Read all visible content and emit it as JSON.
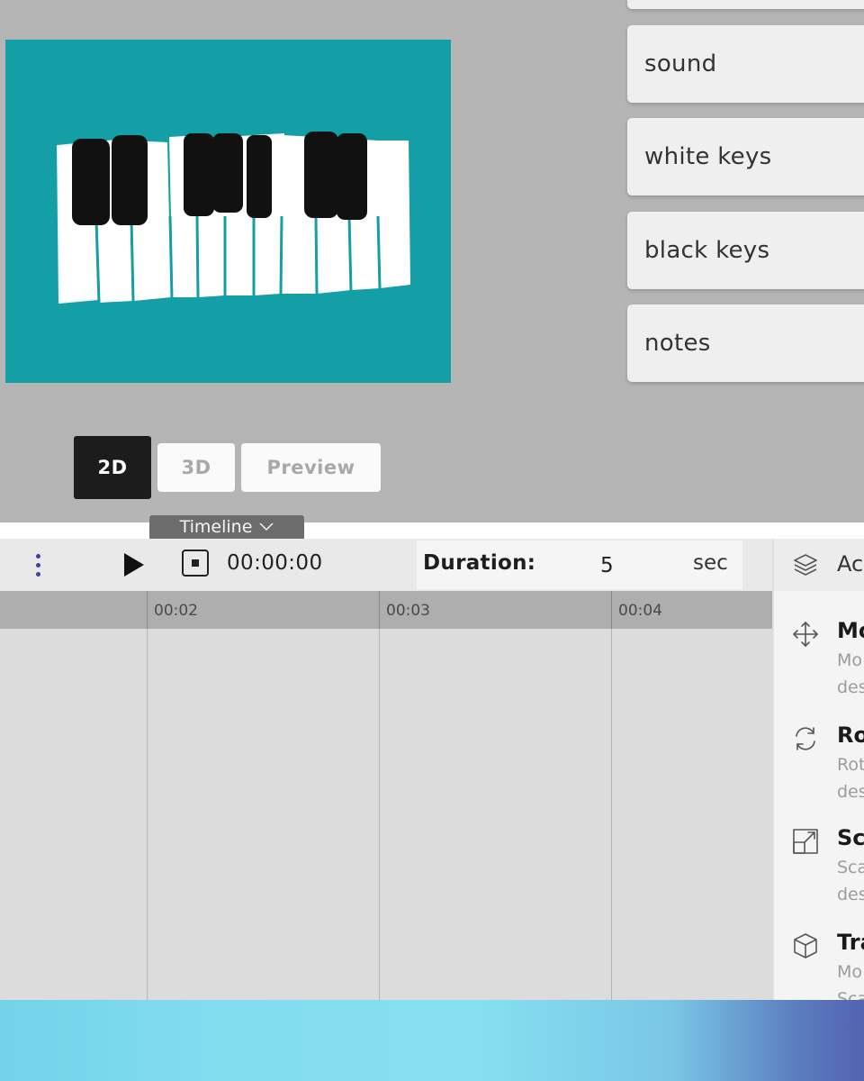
{
  "layers": {
    "items": [
      {
        "label": ""
      },
      {
        "label": "sound"
      },
      {
        "label": "white keys"
      },
      {
        "label": "black keys"
      },
      {
        "label": "notes"
      }
    ]
  },
  "modes": {
    "twod": "2D",
    "threed": "3D",
    "preview": "Preview",
    "active": "2D"
  },
  "timeline": {
    "toggle_label": "Timeline",
    "current_time": "00:00:00",
    "duration_label": "Duration:",
    "duration_value": "5",
    "duration_unit": "sec",
    "ticks": [
      "00:02",
      "00:03",
      "00:04"
    ]
  },
  "actions": {
    "title": "Ac",
    "items": [
      {
        "name": "Mo",
        "desc1": "Mo",
        "desc2": "des",
        "icon": "move-icon"
      },
      {
        "name": "Ro",
        "desc1": "Rot",
        "desc2": "des",
        "icon": "rotate-icon"
      },
      {
        "name": "Sc",
        "desc1": "Sca",
        "desc2": "des",
        "icon": "scale-icon"
      },
      {
        "name": "Tra",
        "desc1": "Mo",
        "desc2": "Sca",
        "icon": "transform-cube-icon"
      }
    ]
  },
  "colors": {
    "canvas_bg": "#139fa5",
    "active_mode": "#1c1c1c",
    "kebab": "#3d3ea8"
  }
}
